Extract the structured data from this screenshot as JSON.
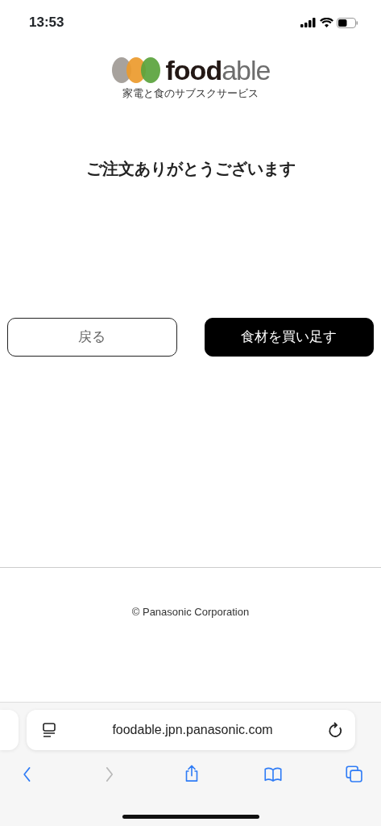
{
  "status_bar": {
    "time": "13:53"
  },
  "logo": {
    "parts": [
      {
        "text": "food",
        "kind": "dark"
      },
      {
        "text": "able",
        "kind": "light"
      }
    ],
    "tagline": "家電と食のサブスクサービス"
  },
  "title": "ご注文ありがとうございます",
  "buttons": [
    {
      "label": "戻る",
      "kind": "outline"
    },
    {
      "label": "食材を買い足す",
      "kind": "solid"
    }
  ],
  "footer": {
    "copyright": "© Panasonic Corporation"
  },
  "browser": {
    "url": "foodable.jpn.panasonic.com",
    "toolbar": [
      {
        "kind": "back",
        "disabled": false
      },
      {
        "kind": "forward",
        "disabled": true
      },
      {
        "kind": "share",
        "disabled": false
      },
      {
        "kind": "bookmarks",
        "disabled": false
      },
      {
        "kind": "tabs",
        "disabled": false
      }
    ]
  }
}
